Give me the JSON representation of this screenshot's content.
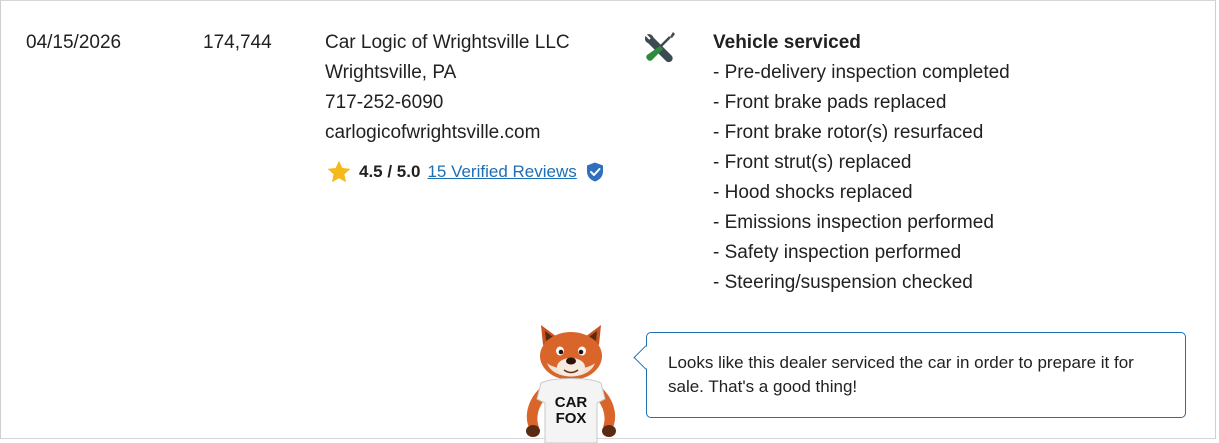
{
  "record": {
    "date": "04/15/2026",
    "odometer": "174,744",
    "dealer": {
      "name": "Car Logic of Wrightsville LLC",
      "location": "Wrightsville, PA",
      "phone": "717-252-6090",
      "website": "carlogicofwrightsville.com",
      "rating": "4.5 / 5.0",
      "reviews_link": "15 Verified Reviews"
    },
    "service": {
      "title": "Vehicle serviced",
      "items": [
        "- Pre-delivery inspection completed",
        "- Front brake pads replaced",
        "- Front brake rotor(s) resurfaced",
        "- Front strut(s) replaced",
        "- Hood shocks replaced",
        "- Emissions inspection performed",
        "- Safety inspection performed",
        "- Steering/suspension checked"
      ]
    },
    "tip": {
      "message": "Looks like this dealer serviced the car in order to prepare it for sale. That's a good thing!",
      "mascot_shirt_line1": "CAR",
      "mascot_shirt_line2": "FOX"
    }
  },
  "icons": {
    "service": "tools-icon",
    "rating": "star-icon",
    "verified": "verified-shield-icon",
    "mascot": "carfox-mascot"
  },
  "colors": {
    "link": "#1d6fb5",
    "star": "#f6b91a",
    "bubble_border": "#1f6fb3",
    "tools_green": "#2e8b3e"
  }
}
